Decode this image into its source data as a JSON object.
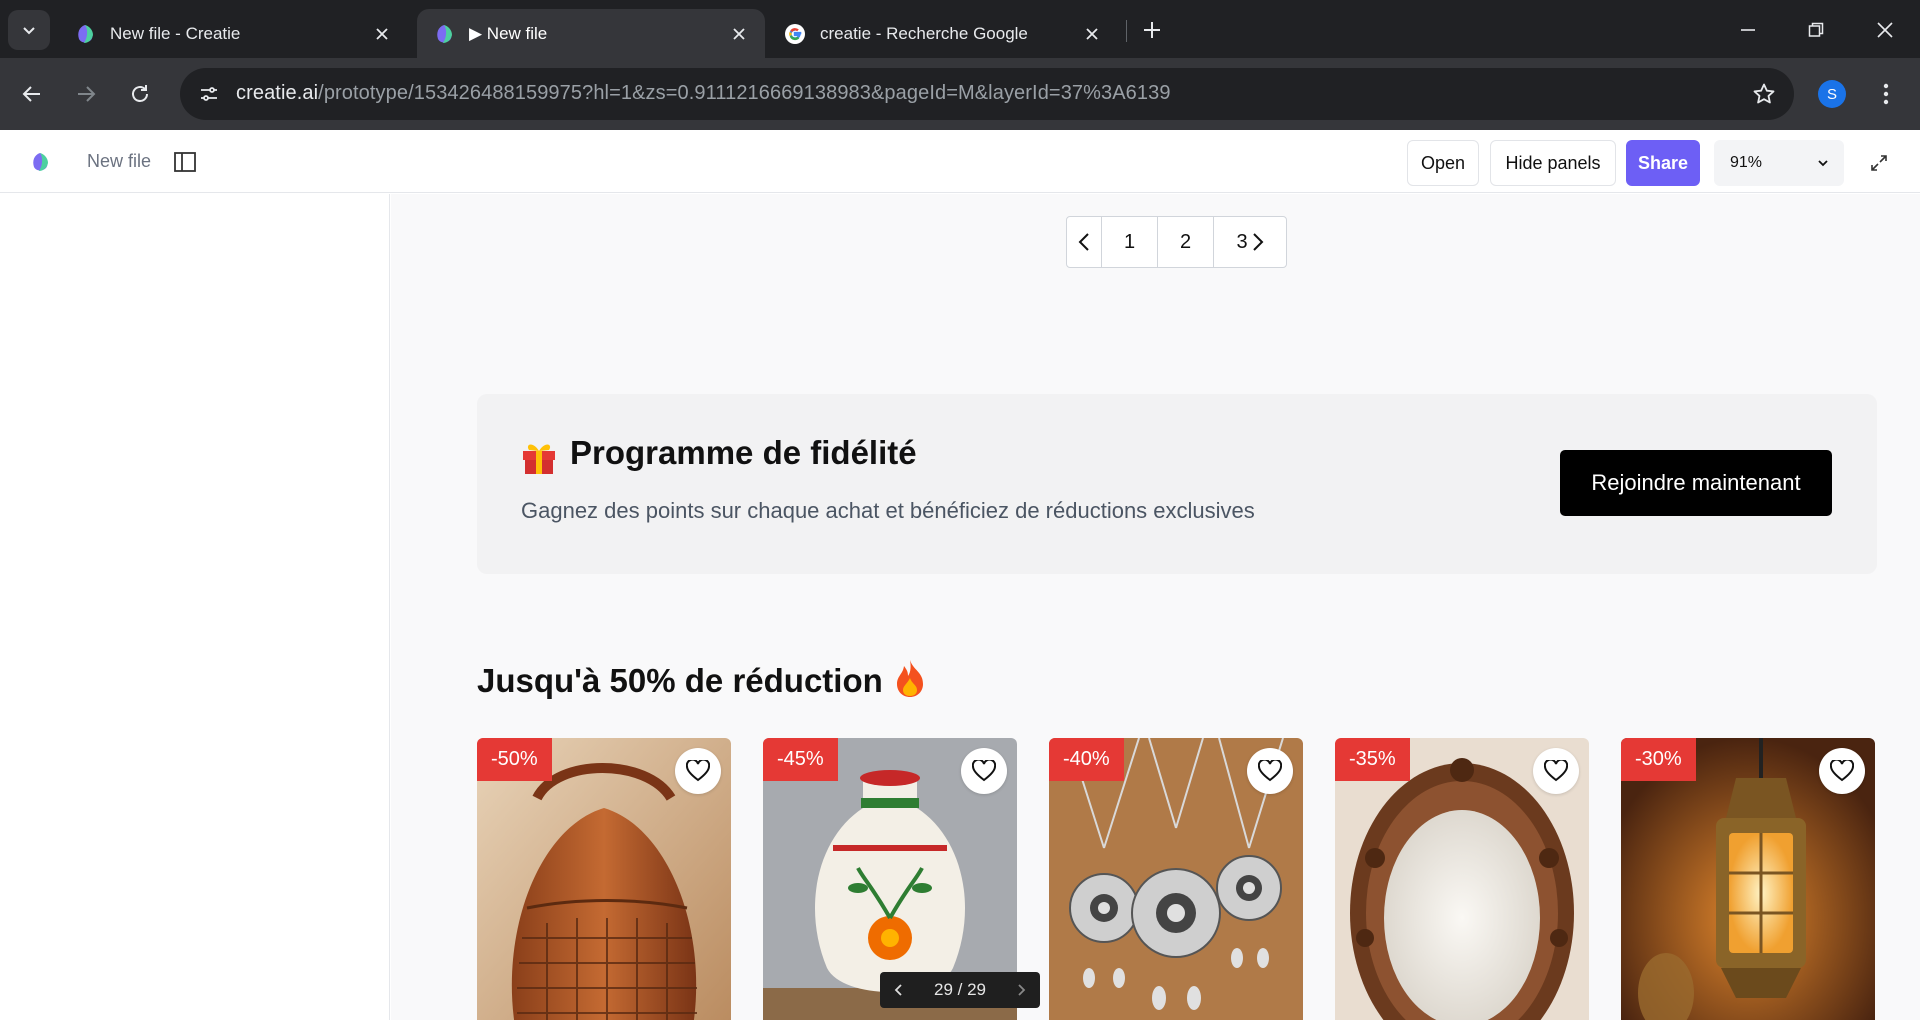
{
  "browser": {
    "tabs": [
      {
        "title": "New file - Creatie",
        "active": false
      },
      {
        "title": "▶ New file",
        "active": true
      },
      {
        "title": "creatie - Recherche Google",
        "active": false
      }
    ],
    "url_host": "creatie.ai",
    "url_path": "/prototype/153426488159975?hl=1&zs=0.9111216669138983&pageId=M&layerId=37%3A6139",
    "profile_initial": "S"
  },
  "app": {
    "file_name": "New file",
    "open_label": "Open",
    "hide_panels_label": "Hide panels",
    "share_label": "Share",
    "zoom": "91%",
    "accent_color": "#6d5ff5"
  },
  "pagination": {
    "pages": [
      "1",
      "2",
      "3"
    ]
  },
  "loyalty": {
    "title": "Programme de fidélité",
    "subtitle": "Gagnez des points sur chaque achat et bénéficiez de réductions exclusives",
    "cta": "Rejoindre maintenant"
  },
  "deals": {
    "title": "Jusqu'à 50% de réduction",
    "products": [
      {
        "discount": "-50%",
        "image": "leather-bucket-bag"
      },
      {
        "discount": "-45%",
        "image": "painted-ceramic-vase"
      },
      {
        "discount": "-40%",
        "image": "silver-jewelry-set"
      },
      {
        "discount": "-35%",
        "image": "carved-wooden-mirror"
      },
      {
        "discount": "-30%",
        "image": "brass-lantern"
      }
    ],
    "badge_color": "#e53935"
  },
  "slide_counter": "29 / 29"
}
